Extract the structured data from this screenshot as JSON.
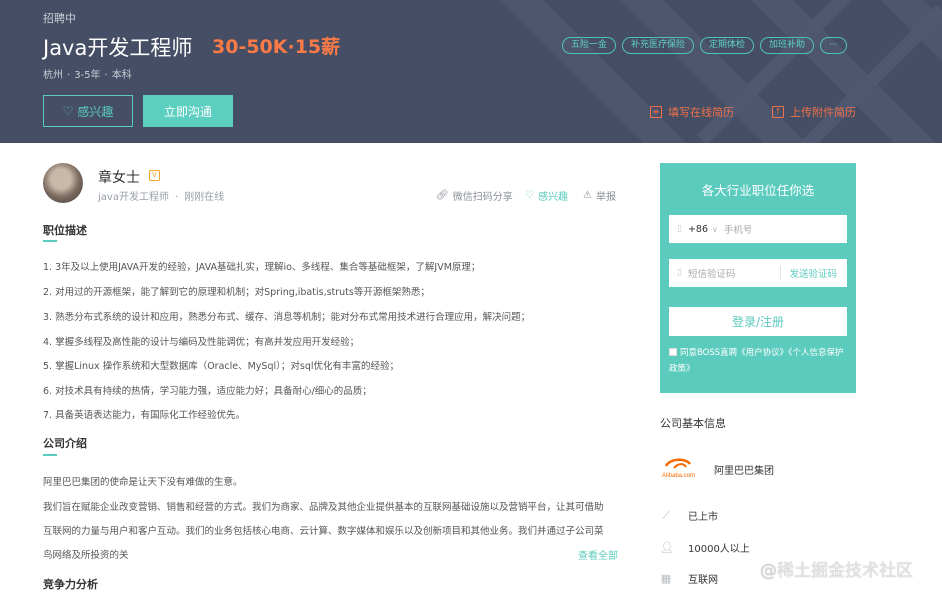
{
  "job": {
    "status": "招聘中",
    "title": "Java开发工程师",
    "salary": "30-50K·15薪",
    "city": "杭州",
    "experience": "3-5年",
    "education": "本科",
    "meta_sep": "·",
    "tags": [
      "五险一金",
      "补充医疗保险",
      "定期体检",
      "加班补助",
      "···"
    ],
    "interest_label": "感兴趣",
    "chat_label": "立即沟通",
    "resume_online_label": "填写在线简历",
    "resume_upload_label": "上传附件简历"
  },
  "recruiter": {
    "name": "章女士",
    "badge": "V",
    "position": "java开发工程师",
    "dot": "·",
    "online": "刚刚在线",
    "share_label": "微信扫码分享",
    "like_label": "感兴趣",
    "report_label": "举报"
  },
  "description": {
    "title": "职位描述",
    "lines": [
      "1. 3年及以上使用JAVA开发的经验，JAVA基础扎实，理解io、多线程、集合等基础框架，了解JVM原理；",
      "2. 对用过的开源框架，能了解到它的原理和机制；对Spring,ibatis,struts等开源框架熟悉；",
      "3. 熟悉分布式系统的设计和应用，熟悉分布式、缓存、消息等机制；能对分布式常用技术进行合理应用，解决问题；",
      "4. 掌握多线程及高性能的设计与编码及性能调优；有高并发应用开发经验；",
      "5. 掌握Linux 操作系统和大型数据库（Oracle、MySql）；对sql优化有丰富的经验；",
      "6. 对技术具有持续的热情，学习能力强，适应能力好；具备耐心/细心的品质；",
      "7. 具备英语表达能力，有国际化工作经验优先。"
    ]
  },
  "company_intro": {
    "title": "公司介绍",
    "lines": [
      "阿里巴巴集团的使命是让天下没有难做的生意。",
      "我们旨在赋能企业改变营销、销售和经营的方式。我们为商家、品牌及其他企业提供基本的互联网基础设施以及营销平台，让其可借助",
      "互联网的力量与用户和客户互动。我们的业务包括核心电商、云计算、数字媒体和娱乐以及创新项目和其他业务。我们并通过子公司菜",
      "鸟网络及所投资的关"
    ],
    "view_all": "查看全部"
  },
  "competitiveness": {
    "title": "竞争力分析"
  },
  "login": {
    "title": "各大行业职位任你选",
    "country_code": "+86",
    "phone_placeholder": "手机号",
    "code_placeholder": "短信验证码",
    "send_code": "发送验证码",
    "submit": "登录/注册",
    "agree_text": "同意BOSS直聘《用户协议》《个人信息保护政策》"
  },
  "company_info": {
    "title": "公司基本信息",
    "name": "阿里巴巴集团",
    "logo_text": "Alibaba.com",
    "rows": [
      {
        "icon": "chart-icon",
        "text": "已上市"
      },
      {
        "icon": "people-icon",
        "text": "10000人以上"
      },
      {
        "icon": "grid-icon",
        "text": "互联网"
      }
    ]
  },
  "watermark": {
    "at": "@",
    "text": "稀土掘金技术社区"
  },
  "colors": {
    "header_bg": "#454e64",
    "accent": "#5bcbbe",
    "salary": "#fa7a47",
    "resume_link": "#f0714a"
  }
}
